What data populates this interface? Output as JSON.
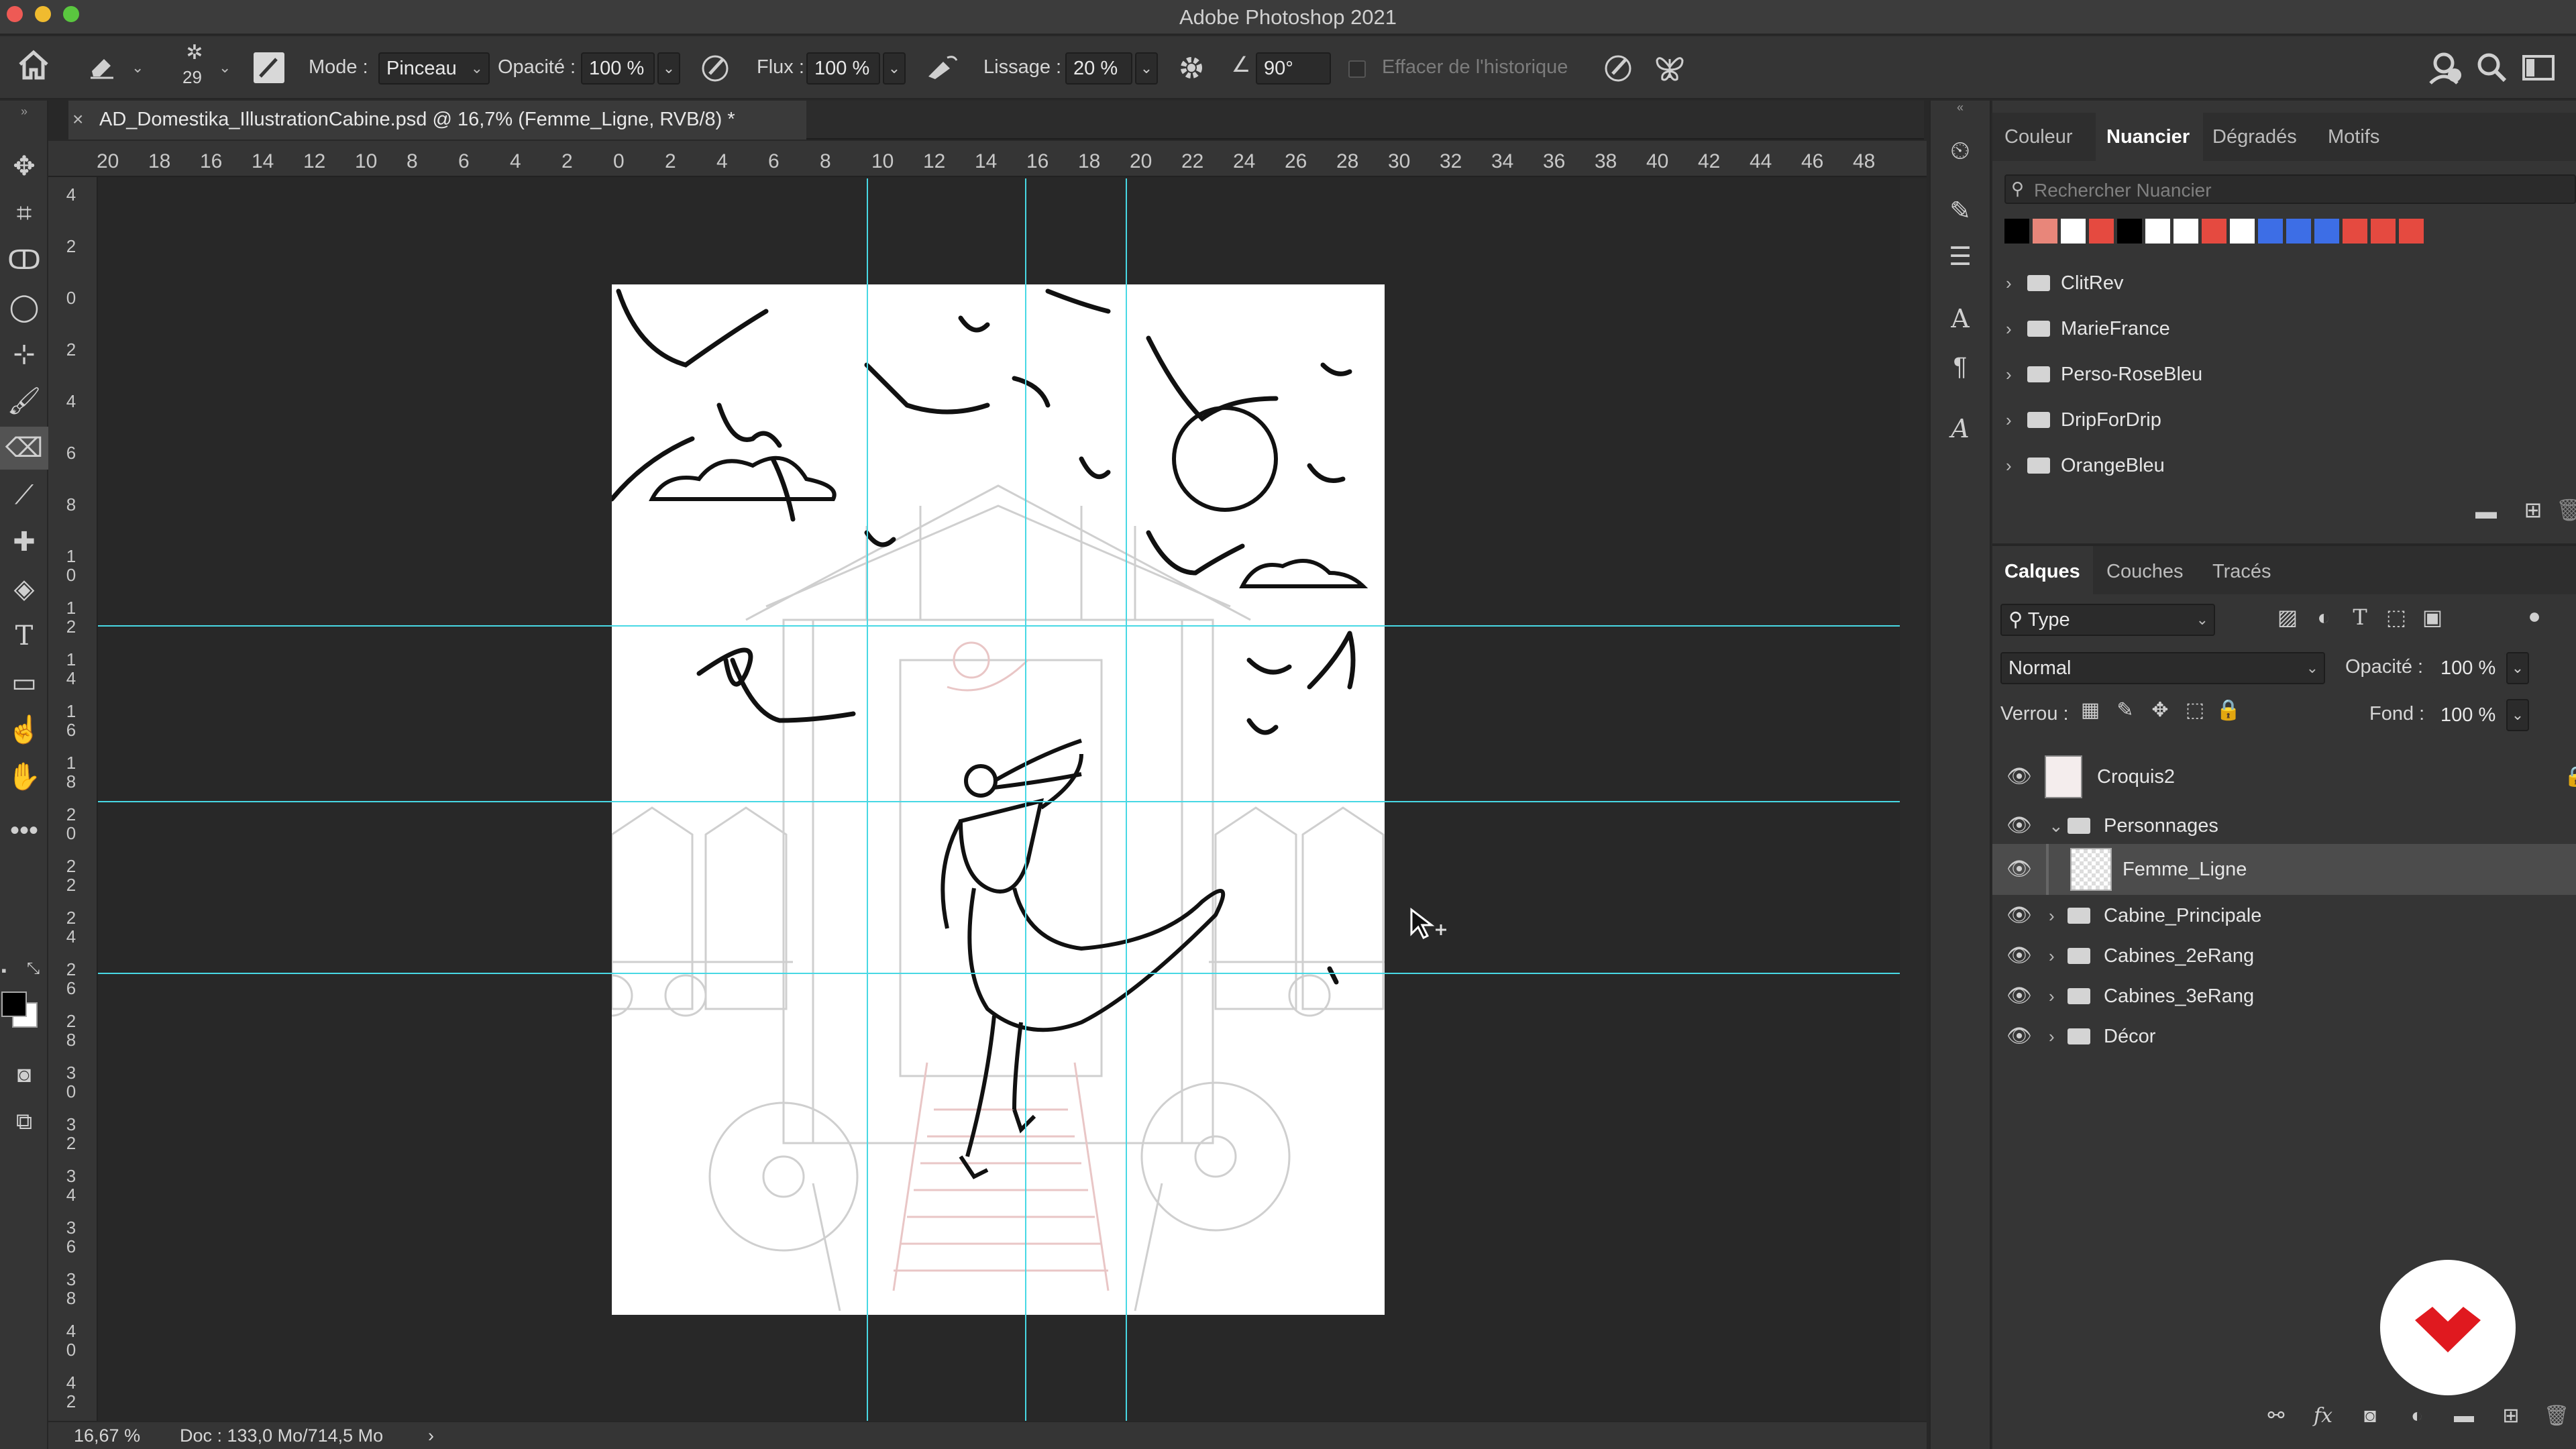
{
  "app": {
    "title": "Adobe Photoshop 2021"
  },
  "options_bar": {
    "brush_size": "29",
    "mode_label": "Mode :",
    "mode_value": "Pinceau",
    "opacity_label": "Opacité :",
    "opacity_value": "100 %",
    "flow_label": "Flux :",
    "flow_value": "100 %",
    "smoothing_label": "Lissage :",
    "smoothing_value": "20 %",
    "angle_value": "90°",
    "erase_history_label": "Effacer de l'historique"
  },
  "document": {
    "tab_title": "AD_Domestika_IllustrationCabine.psd @ 16,7% (Femme_Ligne, RVB/8) *",
    "tab_close": "×"
  },
  "rulers": {
    "top_ticks": [
      "20",
      "18",
      "16",
      "14",
      "12",
      "10",
      "8",
      "6",
      "4",
      "2",
      "0",
      "2",
      "4",
      "6",
      "8",
      "10",
      "12",
      "14",
      "16",
      "18",
      "20",
      "22",
      "24",
      "26",
      "28",
      "30",
      "32",
      "34",
      "36",
      "38",
      "40",
      "42",
      "44",
      "46",
      "48"
    ],
    "left_ticks": [
      "4",
      "2",
      "0",
      "2",
      "4",
      "6",
      "8",
      "1\n0",
      "1\n2",
      "1\n4",
      "1\n6",
      "1\n8",
      "2\n0",
      "2\n2",
      "2\n4",
      "2\n6",
      "2\n8",
      "3\n0",
      "3\n2",
      "3\n4",
      "3\n6",
      "3\n8",
      "4\n0",
      "4\n2"
    ]
  },
  "statusbar": {
    "zoom": "16,67 %",
    "doc": "Doc : 133,0 Mo/714,5 Mo",
    "arrow": "›"
  },
  "swatches_panel": {
    "tabs": [
      "Couleur",
      "Nuancier",
      "Dégradés",
      "Motifs"
    ],
    "active_tab": 1,
    "search_placeholder": "Rechercher Nuancier",
    "swatches": [
      "#000000",
      "#e8867a",
      "#ffffff",
      "#e54a40",
      "#000000",
      "#ffffff",
      "#ffffff",
      "#e54a40",
      "#ffffff",
      "#3d6ee6",
      "#3d6ee6",
      "#3d6ee6",
      "#e54a40",
      "#e54a40",
      "#e54a40"
    ],
    "folders": [
      "ClitRev",
      "MarieFrance",
      "Perso-RoseBleu",
      "DripForDrip",
      "OrangeBleu"
    ]
  },
  "layers_panel": {
    "tabs": [
      "Calques",
      "Couches",
      "Tracés"
    ],
    "active_tab": 0,
    "filter_value": "Type",
    "blend_mode": "Normal",
    "opacity_label": "Opacité :",
    "opacity_value": "100 %",
    "lock_label": "Verrou :",
    "fill_label": "Fond :",
    "fill_value": "100 %",
    "layers": [
      {
        "name": "Croquis2",
        "kind": "layer"
      },
      {
        "name": "Personnages",
        "kind": "group-open"
      },
      {
        "name": "Femme_Ligne",
        "kind": "layer-selected"
      },
      {
        "name": "Cabine_Principale",
        "kind": "group"
      },
      {
        "name": "Cabines_2eRang",
        "kind": "group"
      },
      {
        "name": "Cabines_3eRang",
        "kind": "group"
      },
      {
        "name": "Décor",
        "kind": "group"
      }
    ]
  },
  "colors": {
    "guide": "#48d8e4",
    "logo_red": "#e0191f",
    "panel": "#353535",
    "canvas_bg": "#282828"
  }
}
